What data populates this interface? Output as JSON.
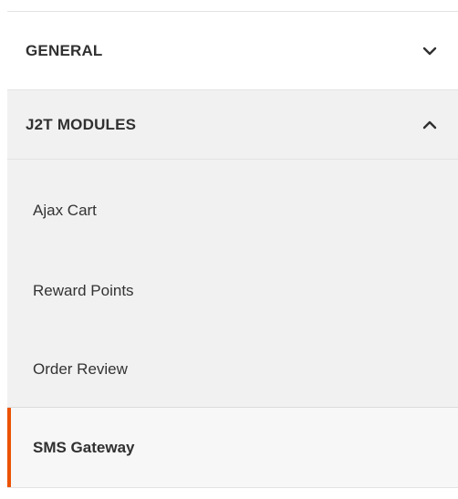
{
  "sections": {
    "general": {
      "label": "GENERAL",
      "expanded": false,
      "icon": "chevron-down-icon"
    },
    "modules": {
      "label": "J2T MODULES",
      "expanded": true,
      "icon": "chevron-up-icon"
    }
  },
  "module_items": [
    {
      "label": "Ajax Cart",
      "active": false
    },
    {
      "label": "Reward Points",
      "active": false
    },
    {
      "label": "Order Review",
      "active": false
    },
    {
      "label": "SMS Gateway",
      "active": true
    }
  ],
  "colors": {
    "accent": "#eb5202",
    "section_bg": "#f1f1f1",
    "text": "#303030",
    "border": "#e3e3e3"
  }
}
